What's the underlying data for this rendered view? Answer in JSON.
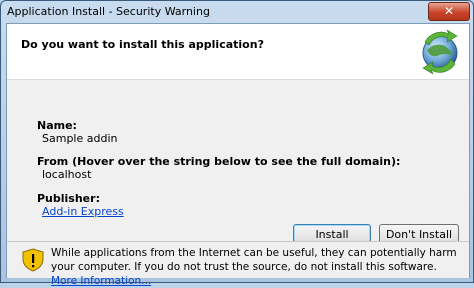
{
  "window": {
    "title": "Application Install - Security Warning",
    "close_glyph": "✕"
  },
  "header": {
    "question": "Do you want to install this application?",
    "icon": "clickonce-app-icon"
  },
  "details": {
    "name_label": "Name:",
    "name_value": "Sample addin",
    "from_label": "From (Hover over the string below to see the full domain):",
    "from_value": "localhost",
    "publisher_label": "Publisher:",
    "publisher_value": "Add-in Express"
  },
  "buttons": {
    "install": "Install",
    "dont_install": "Don't Install"
  },
  "footer": {
    "warning_text": "While applications from the Internet can be useful, they can potentially harm your computer. If you do not trust the source, do not install this software. ",
    "more_info": "More Information...",
    "icon": "warning-shield-icon"
  },
  "colors": {
    "link": "#0645c8",
    "title_bar": "#bcd3ea",
    "body_bg": "#f0f0f0"
  }
}
